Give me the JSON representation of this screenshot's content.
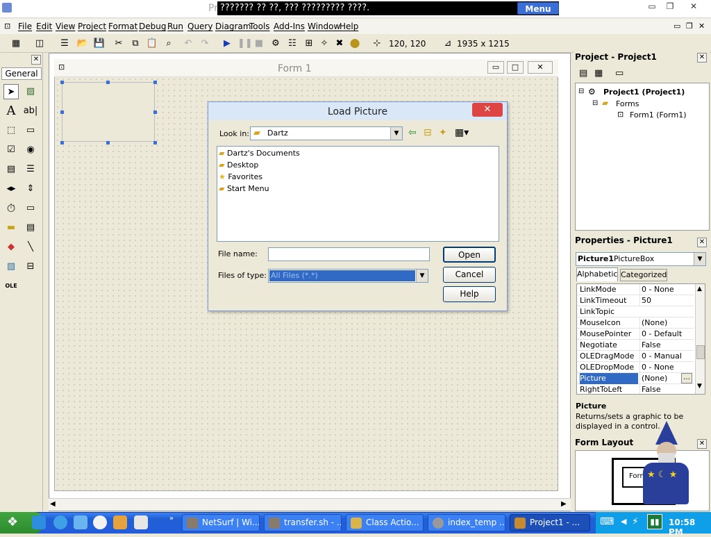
{
  "window": {
    "title_prefix": "Pr",
    "title": "??????? ?? ??, ??? ????????? ????.",
    "menu_label": "Menu",
    "controls": [
      "▭",
      "❐",
      "✕"
    ]
  },
  "menubar": {
    "items": [
      "File",
      "Edit",
      "View",
      "Project",
      "Format",
      "Debug",
      "Run",
      "Query",
      "Diagram",
      "Tools",
      "Add-Ins",
      "Window",
      "Help"
    ]
  },
  "toolbar": {
    "position": "120, 120",
    "size": "1935 x 1215"
  },
  "toolbox": {
    "header": "General",
    "tools": [
      "pointer-icon",
      "picturebox-icon",
      "label-icon",
      "textbox-icon",
      "frame-icon",
      "commandbutton-icon",
      "checkbox-icon",
      "optionbutton-icon",
      "combobox-icon",
      "listbox-icon",
      "hscrollbar-icon",
      "vscrollbar-icon",
      "timer-icon",
      "drivelistbox-icon",
      "dirlistbox-icon",
      "filelistbox-icon",
      "shape-icon",
      "line-icon",
      "image-icon",
      "data-icon",
      "ole-icon"
    ]
  },
  "form": {
    "title": "Form 1"
  },
  "dialog": {
    "title": "Load Picture",
    "look_in_label": "Look in:",
    "look_in_value": "Dartz",
    "files": [
      {
        "name": "Dartz's Documents",
        "icon": "folder-icon"
      },
      {
        "name": "Desktop",
        "icon": "folder-icon"
      },
      {
        "name": "Favorites",
        "icon": "star-icon"
      },
      {
        "name": "Start Menu",
        "icon": "folder-icon"
      }
    ],
    "file_name_label": "File name:",
    "file_name_value": "",
    "files_of_type_label": "Files of type:",
    "files_of_type_value": "All Files (*.*)",
    "open_label": "Open",
    "cancel_label": "Cancel",
    "help_label": "Help"
  },
  "project_panel": {
    "title": "Project - Project1",
    "tree": {
      "root": "Project1 (Project1)",
      "folder": "Forms",
      "leaf": "Form1 (Form1)"
    }
  },
  "properties_panel": {
    "title": "Properties - Picture1",
    "object_name": "Picture1",
    "object_type": "PictureBox",
    "tabs": [
      "Alphabetic",
      "Categorized"
    ],
    "rows": [
      {
        "name": "LinkMode",
        "value": "0 - None"
      },
      {
        "name": "LinkTimeout",
        "value": "50"
      },
      {
        "name": "LinkTopic",
        "value": ""
      },
      {
        "name": "MouseIcon",
        "value": "(None)"
      },
      {
        "name": "MousePointer",
        "value": "0 - Default"
      },
      {
        "name": "Negotiate",
        "value": "False"
      },
      {
        "name": "OLEDragMode",
        "value": "0 - Manual"
      },
      {
        "name": "OLEDropMode",
        "value": "0 - None"
      },
      {
        "name": "Picture",
        "value": "(None)"
      },
      {
        "name": "RightToLeft",
        "value": "False"
      }
    ],
    "selected": "Picture",
    "description_title": "Picture",
    "description_text": "Returns/sets a graphic to be displayed in a control."
  },
  "form_layout_panel": {
    "title": "Form Layout",
    "preview_label": "Form"
  },
  "taskbar": {
    "tasks": [
      {
        "label": "NetSurf | Wi...",
        "color": "#8a7a6a"
      },
      {
        "label": "transfer.sh - ...",
        "color": "#8a7a6a"
      },
      {
        "label": "Class Actio...",
        "color": "#d9b44a"
      },
      {
        "label": "index_temp ...",
        "color": "#999999"
      },
      {
        "label": "Project1 - ...",
        "color": "#c88a2e"
      }
    ],
    "clock": "10:58 PM"
  }
}
